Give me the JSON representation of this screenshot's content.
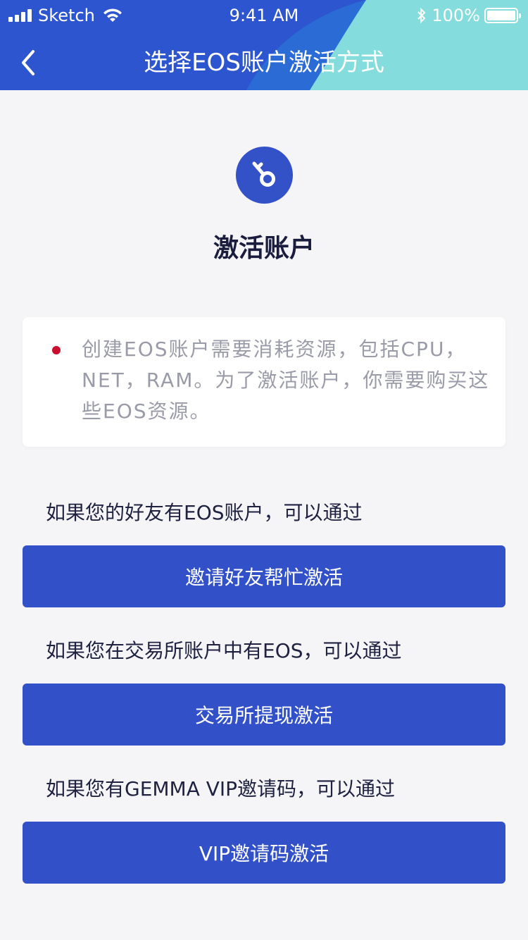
{
  "status_bar": {
    "carrier": "Sketch",
    "time": "9:41 AM",
    "battery": "100%"
  },
  "nav": {
    "title": "选择EOS账户激活方式",
    "back_icon": "chevron-left-icon"
  },
  "hero": {
    "icon": "key-icon",
    "title": "激活账户"
  },
  "info": {
    "text": "创建EOS账户需要消耗资源，包括CPU，NET，RAM。为了激活账户，你需要购买这些EOS资源。",
    "bullet_color": "#c8102e"
  },
  "options": [
    {
      "label": "如果您的好友有EOS账户，可以通过",
      "button": "邀请好友帮忙激活"
    },
    {
      "label": "如果您在交易所账户中有EOS，可以通过",
      "button": "交易所提现激活"
    },
    {
      "label": "如果您有GEMMA VIP邀请码，可以通过",
      "button": "VIP邀请码激活"
    }
  ],
  "colors": {
    "primary": "#3251c8",
    "header_blue": "#2f5bd1",
    "header_accent": "#85dcdc",
    "background": "#f5f5f7"
  }
}
